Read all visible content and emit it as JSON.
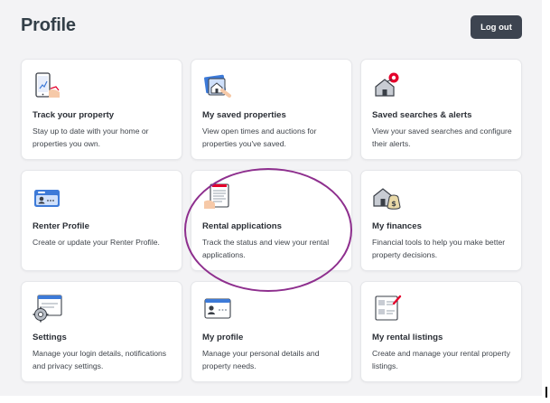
{
  "header": {
    "title": "Profile",
    "logout_label": "Log out"
  },
  "cards": [
    {
      "icon": "phone-house-chart-icon",
      "title": "Track your property",
      "description": "Stay up to date with your home or properties you own."
    },
    {
      "icon": "saved-properties-icon",
      "title": "My saved properties",
      "description": "View open times and auctions for properties you've saved."
    },
    {
      "icon": "saved-search-house-icon",
      "title": "Saved searches & alerts",
      "description": "View your saved searches and configure their alerts."
    },
    {
      "icon": "renter-profile-card-icon",
      "title": "Renter Profile",
      "description": "Create or update your Renter Profile."
    },
    {
      "icon": "rental-application-document-icon",
      "title": "Rental applications",
      "description": "Track the status and view your rental applications."
    },
    {
      "icon": "finances-house-money-icon",
      "title": "My finances",
      "description": "Financial tools to help you make better property decisions."
    },
    {
      "icon": "settings-gear-icon",
      "title": "Settings",
      "description": "Manage your login details, notifications and privacy settings."
    },
    {
      "icon": "profile-card-icon",
      "title": "My profile",
      "description": "Manage your personal details and property needs."
    },
    {
      "icon": "rental-listings-icon",
      "title": "My rental listings",
      "description": "Create and manage your rental property listings."
    }
  ],
  "colors": {
    "background": "#f3f3f5",
    "button": "#3d4450",
    "annotation": "#8e2f8e",
    "icon_blue": "#3d7ad8",
    "icon_red": "#e4002b"
  }
}
